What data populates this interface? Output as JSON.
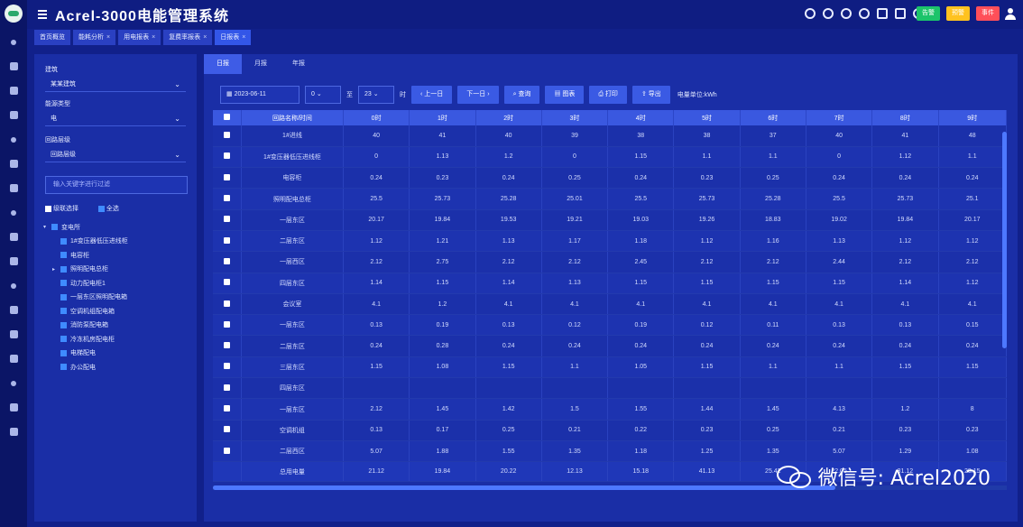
{
  "app": {
    "title": "Acrel-3000电能管理系统"
  },
  "header_badges": [
    {
      "label": "告警",
      "count": ""
    },
    {
      "label": "预警",
      "count": ""
    },
    {
      "label": "事件",
      "count": ""
    }
  ],
  "tabs": [
    {
      "label": "首页概览"
    },
    {
      "label": "能耗分析"
    },
    {
      "label": "用电报表"
    },
    {
      "label": "复费率报表"
    },
    {
      "label": "日报表"
    }
  ],
  "filters": {
    "building_label": "建筑",
    "building_value": "某某建筑",
    "energy_label": "能源类型",
    "energy_value": "电",
    "level_label": "回路层级",
    "level_value": "回路层级",
    "search_placeholder": "输入关键字进行过滤",
    "cascade_label": "级联选择",
    "all_label": "全选"
  },
  "tree": [
    {
      "label": "变电所",
      "level": 0,
      "arrow": "▾"
    },
    {
      "label": "1#变压器低压进线柜",
      "level": 1,
      "arrow": ""
    },
    {
      "label": "电容柜",
      "level": 1,
      "arrow": ""
    },
    {
      "label": "照明配电总柜",
      "level": 1,
      "arrow": "▸"
    },
    {
      "label": "动力配电柜1",
      "level": 1,
      "arrow": ""
    },
    {
      "label": "一层东区照明配电箱",
      "level": 1,
      "arrow": ""
    },
    {
      "label": "空调机组配电箱",
      "level": 1,
      "arrow": ""
    },
    {
      "label": "消防泵配电箱",
      "level": 1,
      "arrow": ""
    },
    {
      "label": "冷冻机房配电柜",
      "level": 1,
      "arrow": ""
    },
    {
      "label": "电梯配电",
      "level": 1,
      "arrow": ""
    },
    {
      "label": "办公配电",
      "level": 1,
      "arrow": ""
    }
  ],
  "subtabs": [
    {
      "label": "日报"
    },
    {
      "label": "月报"
    },
    {
      "label": "年报"
    }
  ],
  "toolbar": {
    "date_value": "2023-06-11",
    "hour_from": "0",
    "to_label": "至",
    "hour_to": "23",
    "unit_label": "时",
    "prev_button": "上一日",
    "next_button": "下一日",
    "query_button": "查询",
    "chart_button": "图表",
    "print_button": "打印",
    "export_button": "导出",
    "note_text": "电量单位:kWh"
  },
  "table": {
    "headers": [
      "回路名称/时间",
      "0时",
      "1时",
      "2时",
      "3时",
      "4时",
      "5时",
      "6时",
      "7时",
      "8时",
      "9时"
    ],
    "rows": [
      [
        "1#进线",
        "40",
        "41",
        "40",
        "39",
        "38",
        "38",
        "37",
        "40",
        "41",
        "48"
      ],
      [
        "1#变压器低压进线柜",
        "0",
        "1.13",
        "1.2",
        "0",
        "1.15",
        "1.1",
        "1.1",
        "0",
        "1.12",
        "1.1"
      ],
      [
        "电容柜",
        "0.24",
        "0.23",
        "0.24",
        "0.25",
        "0.24",
        "0.23",
        "0.25",
        "0.24",
        "0.24",
        "0.24"
      ],
      [
        "照明配电总柜",
        "25.5",
        "25.73",
        "25.28",
        "25.01",
        "25.5",
        "25.73",
        "25.28",
        "25.5",
        "25.73",
        "25.1"
      ],
      [
        "一层东区",
        "20.17",
        "19.84",
        "19.53",
        "19.21",
        "19.03",
        "19.26",
        "18.83",
        "19.02",
        "19.84",
        "20.17"
      ],
      [
        "二层东区",
        "1.12",
        "1.21",
        "1.13",
        "1.17",
        "1.18",
        "1.12",
        "1.16",
        "1.13",
        "1.12",
        "1.12"
      ],
      [
        "一层西区",
        "2.12",
        "2.75",
        "2.12",
        "2.12",
        "2.45",
        "2.12",
        "2.12",
        "2.44",
        "2.12",
        "2.12"
      ],
      [
        "四层东区",
        "1.14",
        "1.15",
        "1.14",
        "1.13",
        "1.15",
        "1.15",
        "1.15",
        "1.15",
        "1.14",
        "1.12"
      ],
      [
        "会议室",
        "4.1",
        "1.2",
        "4.1",
        "4.1",
        "4.1",
        "4.1",
        "4.1",
        "4.1",
        "4.1",
        "4.1"
      ],
      [
        "一层东区",
        "0.13",
        "0.19",
        "0.13",
        "0.12",
        "0.19",
        "0.12",
        "0.11",
        "0.13",
        "0.13",
        "0.15"
      ],
      [
        "二层东区",
        "0.24",
        "0.28",
        "0.24",
        "0.24",
        "0.24",
        "0.24",
        "0.24",
        "0.24",
        "0.24",
        "0.24"
      ],
      [
        "三层东区",
        "1.15",
        "1.08",
        "1.15",
        "1.1",
        "1.05",
        "1.15",
        "1.1",
        "1.1",
        "1.15",
        "1.15"
      ],
      [
        "四层东区",
        "",
        "",
        "",
        "",
        "",
        "",
        "",
        "",
        "",
        ""
      ],
      [
        "一层东区",
        "2.12",
        "1.45",
        "1.42",
        "1.5",
        "1.55",
        "1.44",
        "1.45",
        "4.13",
        "1.2",
        "8"
      ],
      [
        "空调机组",
        "0.13",
        "0.17",
        "0.25",
        "0.21",
        "0.22",
        "0.23",
        "0.25",
        "0.21",
        "0.23",
        "0.23"
      ],
      [
        "二层西区",
        "5.07",
        "1.88",
        "1.55",
        "1.35",
        "1.18",
        "1.25",
        "1.35",
        "5.07",
        "1.29",
        "1.08"
      ]
    ],
    "sum_row": [
      "总用电量",
      "21.12",
      "19.84",
      "20.22",
      "12.13",
      "15.18",
      "41.13",
      "25.42",
      "22.05",
      "31.12",
      "28.15"
    ]
  },
  "watermark": {
    "text": "微信号: Acrel2020"
  }
}
